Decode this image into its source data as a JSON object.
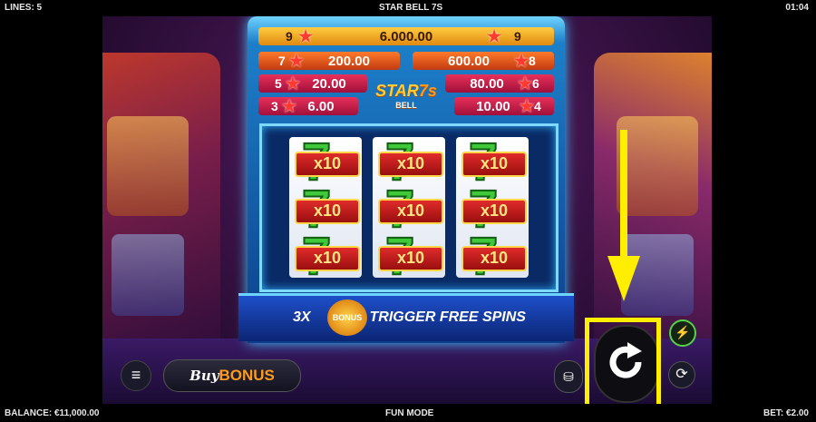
{
  "header": {
    "lines": "LINES: 5",
    "title": "STAR BELL 7S",
    "time": "01:04"
  },
  "footer": {
    "balance": "BALANCE: €11,000.00",
    "mode": "FUN MODE",
    "bet": "BET: €2.00"
  },
  "paytable": {
    "top": {
      "count_left": "9",
      "value": "6.000.00",
      "count_right": "9"
    },
    "left": [
      {
        "count": "7",
        "value": "200.00"
      },
      {
        "count": "5",
        "value": "20.00"
      },
      {
        "count": "3",
        "value": "6.00"
      }
    ],
    "right": [
      {
        "count": "8",
        "value": "600.00"
      },
      {
        "count": "6",
        "value": "80.00"
      },
      {
        "count": "4",
        "value": "10.00"
      }
    ]
  },
  "logo": {
    "line1": "STAR",
    "line2": "BELL",
    "mark": "7s"
  },
  "reels": {
    "multiplier_label": "x10",
    "columns": [
      [
        "x10",
        "x10",
        "x10"
      ],
      [
        "x10",
        "x10",
        "x10"
      ],
      [
        "x10",
        "x10",
        "x10"
      ]
    ]
  },
  "trigger": {
    "prefix": "3X",
    "badge": "BONUS",
    "text": "TRIGGER FREE SPINS"
  },
  "controls": {
    "buy_label": "Buy",
    "bonus_label": "BONUS",
    "menu_icon": "hamburger-icon",
    "stack_icon": "coin-stack-icon",
    "spin_icon": "spin-arrow-icon",
    "turbo_icon": "lightning-icon",
    "autoplay_icon": "autoplay-icon"
  },
  "colors": {
    "highlight": "#ffee00",
    "accent": "#ff9a1a",
    "reel_symbol": "#3fc93a"
  }
}
